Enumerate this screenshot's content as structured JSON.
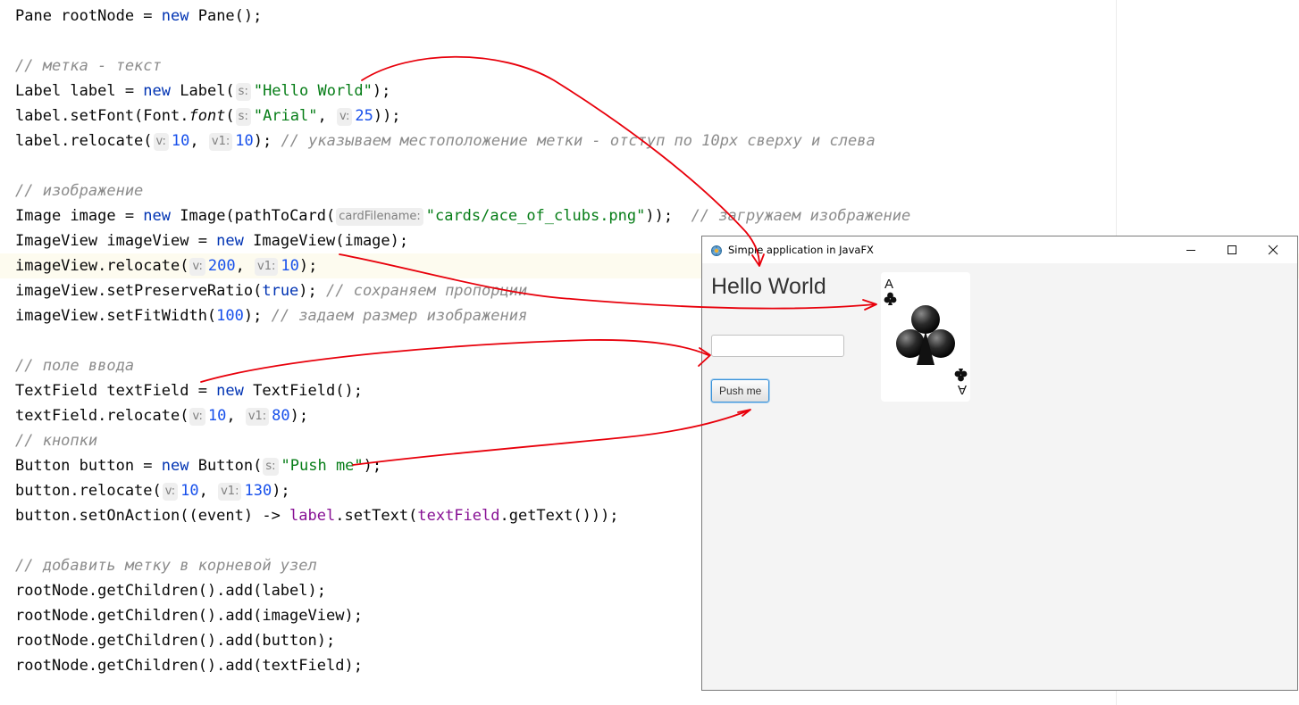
{
  "code": [
    {
      "kind": "code",
      "segs": [
        [
          "t",
          "Pane rootNode = "
        ],
        [
          "kw",
          "new"
        ],
        [
          "t",
          " Pane();"
        ]
      ]
    },
    {
      "kind": "blank",
      "segs": []
    },
    {
      "kind": "comment",
      "segs": [
        [
          "com",
          "// метка - текст"
        ]
      ]
    },
    {
      "kind": "code",
      "segs": [
        [
          "t",
          "Label label = "
        ],
        [
          "kw",
          "new"
        ],
        [
          "t",
          " Label("
        ],
        [
          "hint",
          "s:"
        ],
        [
          "str",
          "\"Hello World\""
        ],
        [
          "t",
          ");"
        ]
      ]
    },
    {
      "kind": "code",
      "segs": [
        [
          "t",
          "label.setFont(Font."
        ],
        [
          "it",
          "font"
        ],
        [
          "t",
          "("
        ],
        [
          "hint",
          "s:"
        ],
        [
          "str",
          "\"Arial\""
        ],
        [
          "t",
          ", "
        ],
        [
          "hint",
          "v:"
        ],
        [
          "num",
          "25"
        ],
        [
          "t",
          "));"
        ]
      ]
    },
    {
      "kind": "code",
      "segs": [
        [
          "t",
          "label.relocate("
        ],
        [
          "hint",
          "v:"
        ],
        [
          "num",
          "10"
        ],
        [
          "t",
          ", "
        ],
        [
          "hint",
          "v1:"
        ],
        [
          "num",
          "10"
        ],
        [
          "t",
          "); "
        ],
        [
          "com",
          "// указываем местоположение метки - отступ по 10px сверху и слева"
        ]
      ]
    },
    {
      "kind": "blank",
      "segs": []
    },
    {
      "kind": "comment",
      "segs": [
        [
          "com",
          "// изображение"
        ]
      ]
    },
    {
      "kind": "code",
      "segs": [
        [
          "t",
          "Image image = "
        ],
        [
          "kw",
          "new"
        ],
        [
          "t",
          " Image(pathToCard("
        ],
        [
          "hint",
          "cardFilename:"
        ],
        [
          "str",
          "\"cards/ace_of_clubs.png\""
        ],
        [
          "t",
          "));  "
        ],
        [
          "com",
          "// загружаем изображение"
        ]
      ]
    },
    {
      "kind": "code",
      "segs": [
        [
          "t",
          "ImageView imageView = "
        ],
        [
          "kw",
          "new"
        ],
        [
          "t",
          " ImageView(image);"
        ]
      ]
    },
    {
      "kind": "code",
      "segs": [
        [
          "t",
          "imageView.relocate("
        ],
        [
          "hint",
          "v:"
        ],
        [
          "num",
          "200"
        ],
        [
          "t",
          ", "
        ],
        [
          "hint",
          "v1:"
        ],
        [
          "num",
          "10"
        ],
        [
          "t",
          ");"
        ]
      ]
    },
    {
      "kind": "code",
      "segs": [
        [
          "t",
          "imageView.setPreserveRatio("
        ],
        [
          "kw",
          "true"
        ],
        [
          "t",
          "); "
        ],
        [
          "com",
          "// сохраняем пропорции"
        ]
      ]
    },
    {
      "kind": "code",
      "segs": [
        [
          "t",
          "imageView.setFitWidth("
        ],
        [
          "num",
          "100"
        ],
        [
          "t",
          "); "
        ],
        [
          "com",
          "// задаем размер изображения"
        ]
      ]
    },
    {
      "kind": "blank",
      "segs": []
    },
    {
      "kind": "comment",
      "segs": [
        [
          "com",
          "// поле ввода"
        ]
      ]
    },
    {
      "kind": "code",
      "segs": [
        [
          "t",
          "TextField textField = "
        ],
        [
          "kw",
          "new"
        ],
        [
          "t",
          " TextField();"
        ]
      ]
    },
    {
      "kind": "code",
      "segs": [
        [
          "t",
          "textField.relocate("
        ],
        [
          "hint",
          "v:"
        ],
        [
          "num",
          "10"
        ],
        [
          "t",
          ", "
        ],
        [
          "hint",
          "v1:"
        ],
        [
          "num",
          "80"
        ],
        [
          "t",
          ");"
        ]
      ]
    },
    {
      "kind": "comment",
      "segs": [
        [
          "com",
          "// кнопки"
        ]
      ]
    },
    {
      "kind": "code",
      "segs": [
        [
          "t",
          "Button button = "
        ],
        [
          "kw",
          "new"
        ],
        [
          "t",
          " Button("
        ],
        [
          "hint",
          "s:"
        ],
        [
          "str",
          "\"Push me\""
        ],
        [
          "t",
          ");"
        ]
      ]
    },
    {
      "kind": "code",
      "segs": [
        [
          "t",
          "button.relocate("
        ],
        [
          "hint",
          "v:"
        ],
        [
          "num",
          "10"
        ],
        [
          "t",
          ", "
        ],
        [
          "hint",
          "v1:"
        ],
        [
          "num",
          "130"
        ],
        [
          "t",
          ");"
        ]
      ]
    },
    {
      "kind": "code",
      "segs": [
        [
          "t",
          "button.setOnAction((event) -> "
        ],
        [
          "fld",
          "label"
        ],
        [
          "t",
          ".setText("
        ],
        [
          "fld",
          "textField"
        ],
        [
          "t",
          ".getText()));"
        ]
      ]
    },
    {
      "kind": "blank",
      "segs": []
    },
    {
      "kind": "comment",
      "segs": [
        [
          "com",
          "// добавить метку в корневой узел"
        ]
      ]
    },
    {
      "kind": "code",
      "segs": [
        [
          "t",
          "rootNode.getChildren().add(label);"
        ]
      ]
    },
    {
      "kind": "code",
      "segs": [
        [
          "t",
          "rootNode.getChildren().add(imageView);"
        ]
      ]
    },
    {
      "kind": "code",
      "segs": [
        [
          "t",
          "rootNode.getChildren().add(button);"
        ]
      ]
    },
    {
      "kind": "code",
      "segs": [
        [
          "t",
          "rootNode.getChildren().add(textField);"
        ]
      ]
    }
  ],
  "window": {
    "title": "Simple application in JavaFX",
    "label_text": "Hello World",
    "textfield_value": "",
    "button_label": "Push me",
    "card": {
      "rank": "A",
      "suit": "clubs"
    },
    "icons": [
      "java-app-icon",
      "minimize-icon",
      "maximize-icon",
      "close-icon"
    ]
  },
  "colors": {
    "keyword": "#0033b3",
    "string": "#067d17",
    "number": "#1750eb",
    "comment": "#8c8c8c",
    "field": "#871094",
    "arrow": "#e8000b",
    "caret_line": "#fdfbef"
  }
}
